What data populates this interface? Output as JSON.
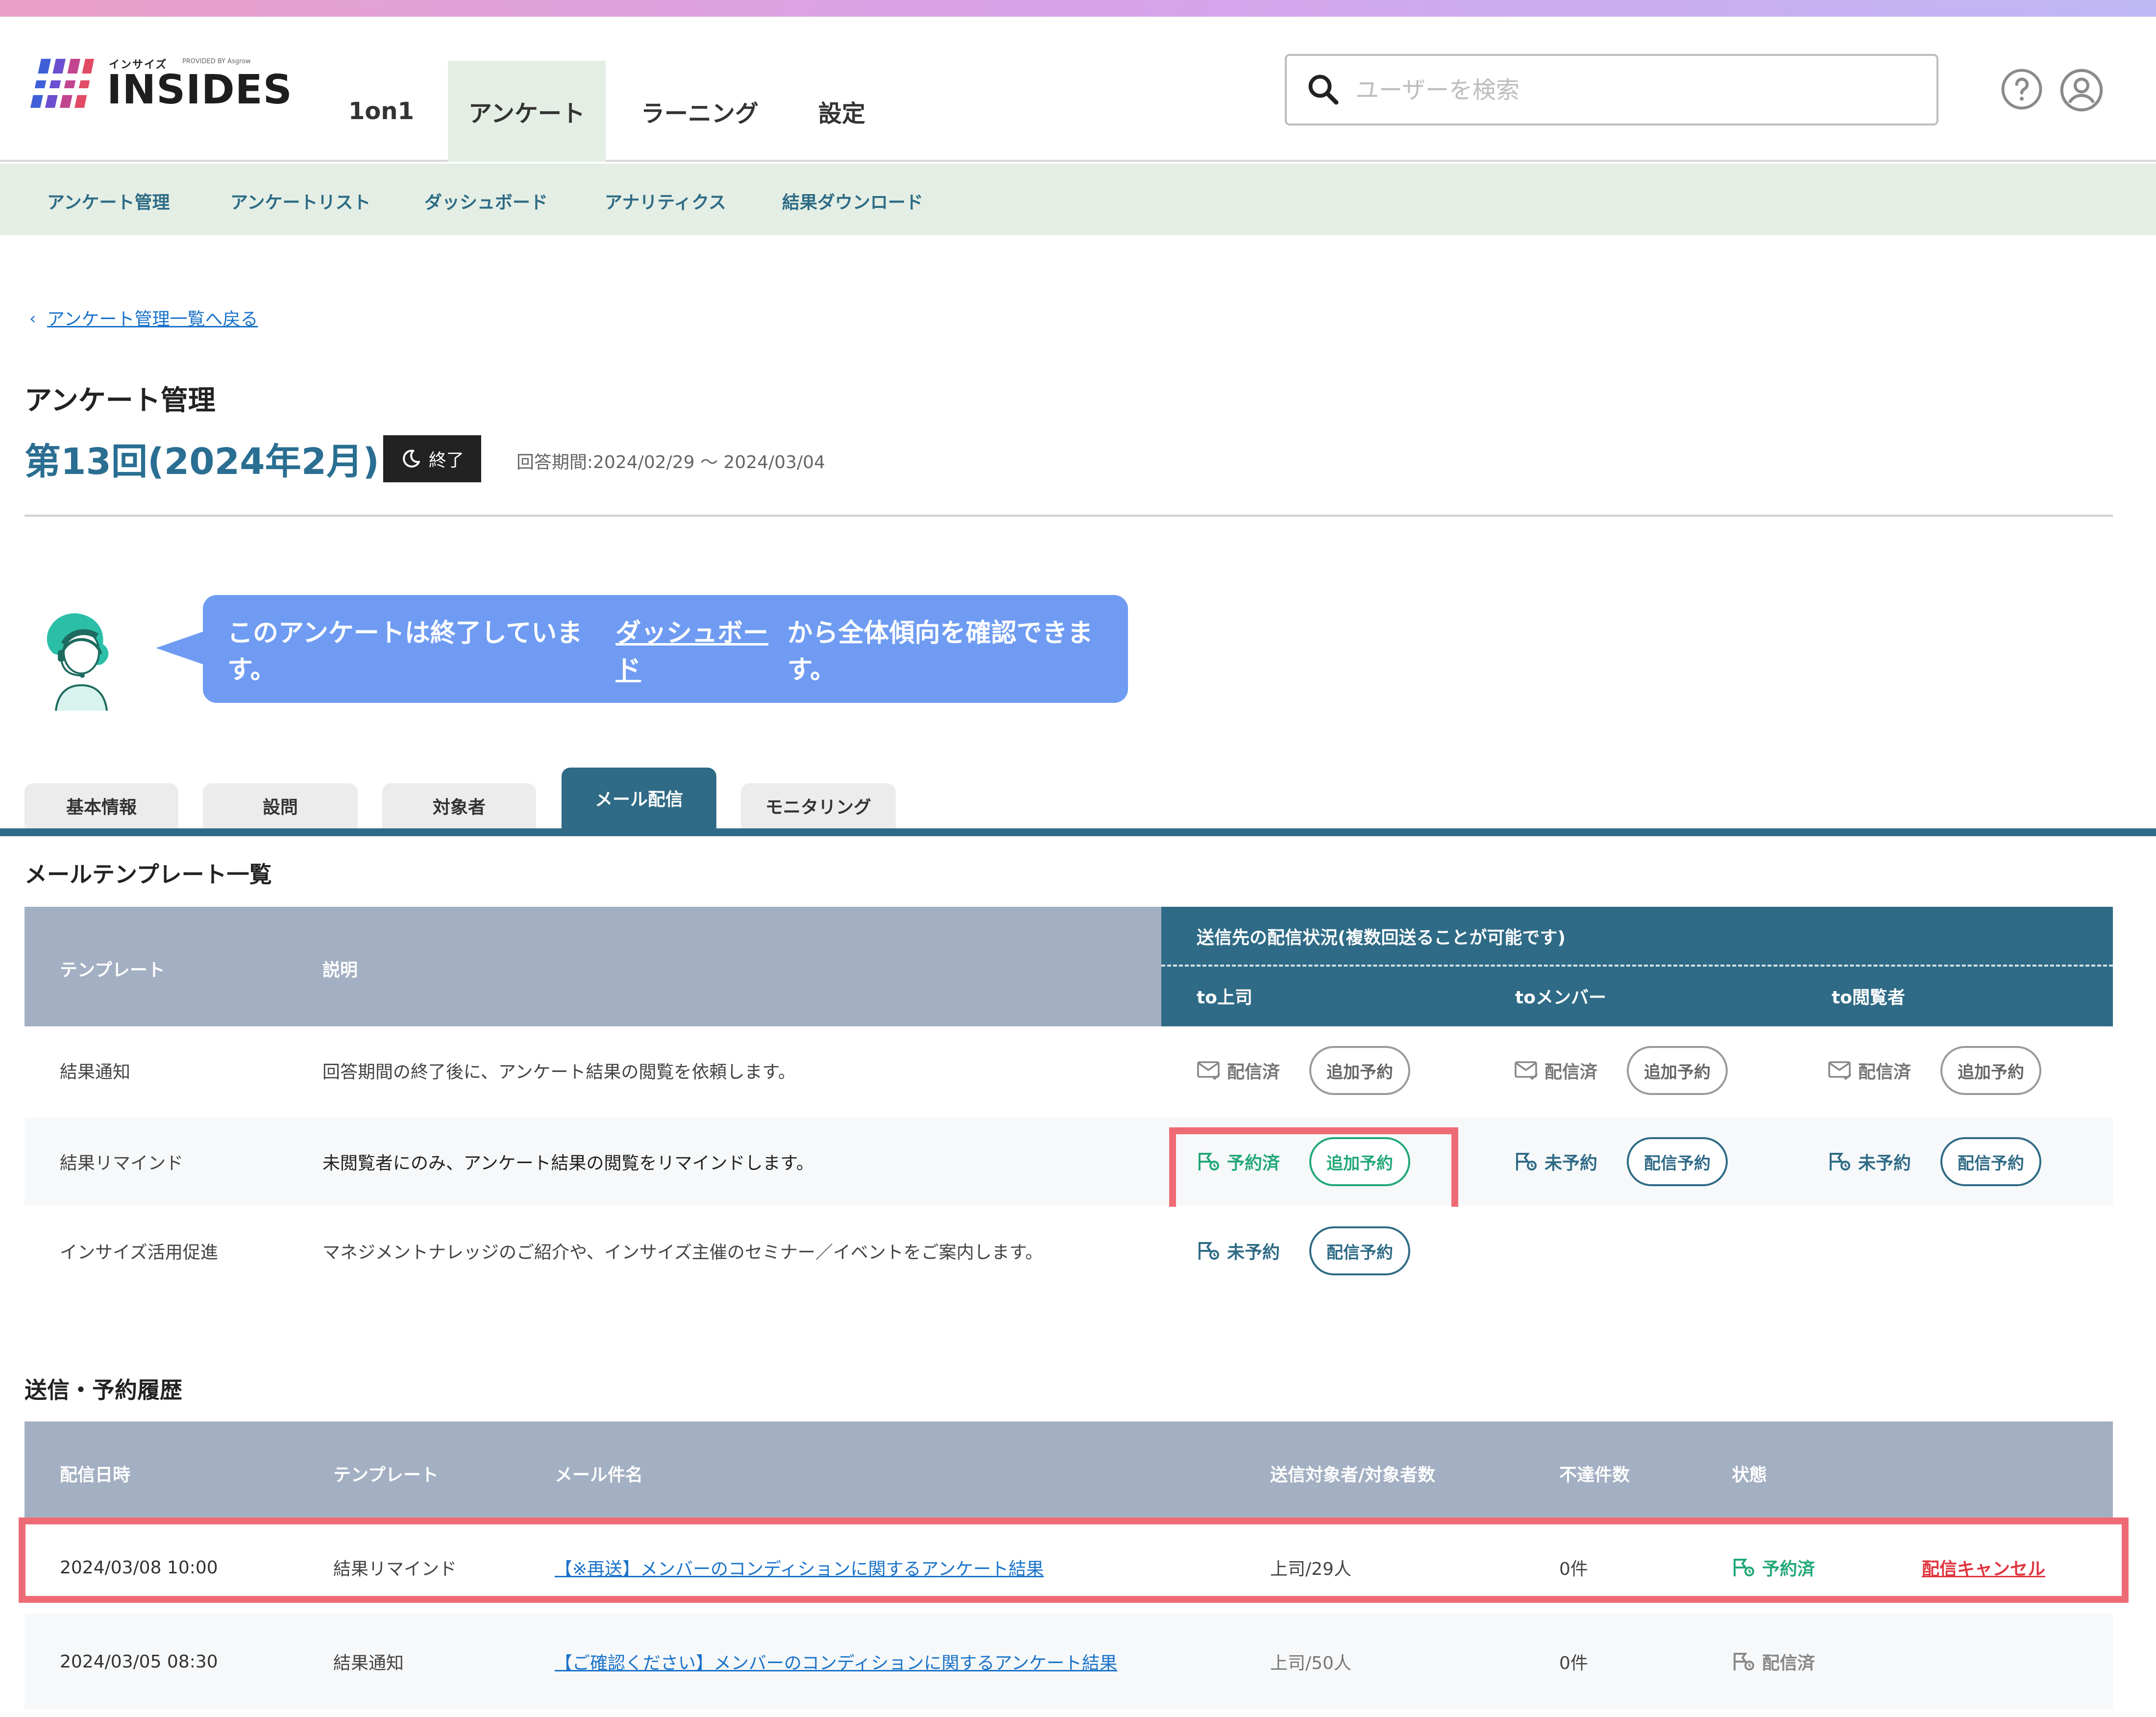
{
  "brand": {
    "small_text": "インサイズ",
    "by_text": "PROVIDED BY Asgrow",
    "name": "INSIDES"
  },
  "nav": {
    "tabs": [
      {
        "label": "1on1"
      },
      {
        "label": "アンケート"
      },
      {
        "label": "ラーニング"
      },
      {
        "label": "設定"
      }
    ]
  },
  "search": {
    "placeholder": "ユーザーを検索"
  },
  "subnav": {
    "items": [
      "アンケート管理",
      "アンケートリスト",
      "ダッシュボード",
      "アナリティクス",
      "結果ダウンロード"
    ]
  },
  "breadcrumb": {
    "back": "アンケート管理一覧へ戻る"
  },
  "page": {
    "title": "アンケート管理",
    "survey_title": "第13回(2024年2月)",
    "status_badge": "終了",
    "period": "回答期間:2024/02/29 ～ 2024/03/04"
  },
  "message": {
    "before": "このアンケートは終了しています。",
    "link": "ダッシュボード",
    "after": "から全体傾向を確認できます。"
  },
  "tabs": [
    "基本情報",
    "設問",
    "対象者",
    "メール配信",
    "モニタリング"
  ],
  "templates": {
    "heading": "メールテンプレート一覧",
    "col_template": "テンプレート",
    "col_desc": "説明",
    "col_status_group": "送信先の配信状況(複数回送ることが可能です)",
    "targets": [
      "to上司",
      "toメンバー",
      "to閲覧者"
    ],
    "rows": [
      {
        "name": "結果通知",
        "desc": "回答期間の終了後に、アンケート結果の閲覧を依頼します。",
        "cells": [
          {
            "status": "配信済",
            "action": "追加予約"
          },
          {
            "status": "配信済",
            "action": "追加予約"
          },
          {
            "status": "配信済",
            "action": "追加予約"
          }
        ]
      },
      {
        "name": "結果リマインド",
        "desc": "未閲覧者にのみ、アンケート結果の閲覧をリマインドします。",
        "cells": [
          {
            "status": "予約済",
            "action": "追加予約"
          },
          {
            "status": "未予約",
            "action": "配信予約"
          },
          {
            "status": "未予約",
            "action": "配信予約"
          }
        ]
      },
      {
        "name": "インサイズ活用促進",
        "desc": "マネジメントナレッジのご紹介や、インサイズ主催のセミナー／イベントをご案内します。",
        "cells": [
          {
            "status": "未予約",
            "action": "配信予約"
          }
        ]
      }
    ]
  },
  "history": {
    "heading": "送信・予約履歴",
    "cols": [
      "配信日時",
      "テンプレート",
      "メール件名",
      "送信対象者/対象者数",
      "不達件数",
      "状態"
    ],
    "rows": [
      {
        "datetime": "2024/03/08 10:00",
        "template": "結果リマインド",
        "subject": "【※再送】メンバーのコンディションに関するアンケート結果",
        "targets": "上司/29人",
        "undelivered": "0件",
        "state": "予約済",
        "action": "配信キャンセル"
      },
      {
        "datetime": "2024/03/05 08:30",
        "template": "結果通知",
        "subject": "【ご確認ください】メンバーのコンディションに関するアンケート結果",
        "targets": "上司/50人",
        "undelivered": "0件",
        "state": "配信済"
      }
    ]
  },
  "colors": {
    "accent": "#2f6b86",
    "subnav_bg": "#e4eee4",
    "bubble": "#6f9cf2",
    "highlight": "#ee6b75",
    "reserved": "#22a877",
    "cancel": "#e0353f"
  }
}
